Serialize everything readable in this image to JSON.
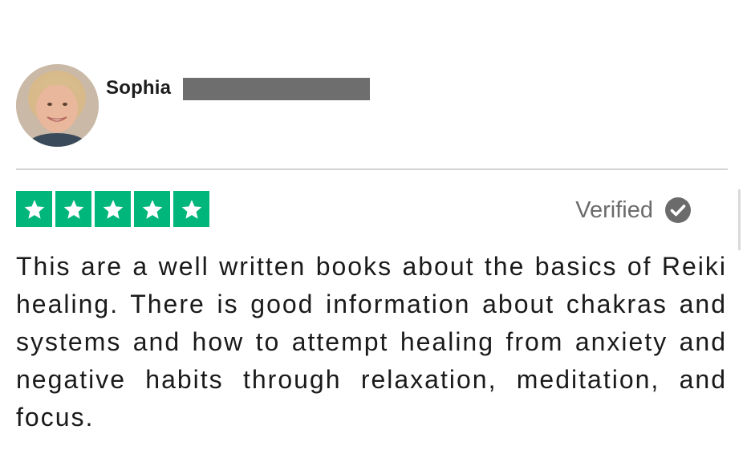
{
  "reviewer": {
    "name": "Sophia",
    "avatar_alt": "reviewer-avatar-photo"
  },
  "rating": {
    "stars": 5,
    "max_stars": 5,
    "color": "#00b67a"
  },
  "status": {
    "verified_label": "Verified",
    "icon": "checkmark-circle-icon"
  },
  "review": {
    "text": "This are a well written books about the basics of Reiki healing. There is good information about chakras and systems and how to attempt healing from anxiety and negative habits through relaxation, meditation, and focus."
  },
  "colors": {
    "star_green": "#00b67a",
    "redaction_gray": "#6e6e6e",
    "verified_gray": "#6b6b6b"
  }
}
